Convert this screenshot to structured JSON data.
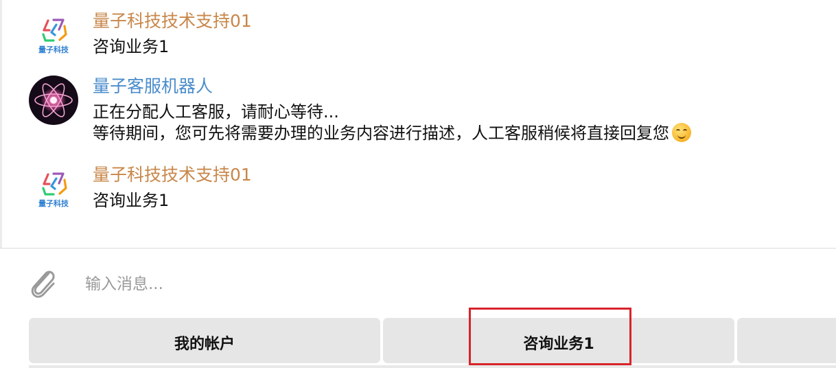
{
  "messages": [
    {
      "sender": "量子科技技术支持01",
      "sender_color": "#c8874a",
      "avatar": "quantum-tech-logo",
      "avatar_text": "量子科技",
      "lines": [
        "咨询业务1"
      ]
    },
    {
      "sender": "量子客服机器人",
      "sender_color": "#4a8ccb",
      "avatar": "atom-orbit-avatar",
      "lines": [
        "正在分配人工客服，请耐心等待...",
        "等待期间，您可先将需要办理的业务内容进行描述，人工客服稍候将直接回复您"
      ],
      "trailing_emoji": "smiling-face-emoji"
    },
    {
      "sender": "量子科技技术支持01",
      "sender_color": "#c8874a",
      "avatar": "quantum-tech-logo",
      "avatar_text": "量子科技",
      "lines": [
        "咨询业务1"
      ]
    }
  ],
  "composer": {
    "attach_icon": "paperclip-icon",
    "placeholder": "输入消息..."
  },
  "keyboard": {
    "buttons": [
      {
        "label": "我的帐户"
      },
      {
        "label": "咨询业务1"
      },
      {
        "label": ""
      }
    ]
  },
  "colors": {
    "highlight": "#d8232a",
    "button_bg": "#e6e6e6"
  }
}
